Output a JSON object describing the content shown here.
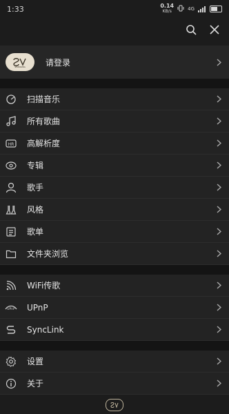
{
  "status": {
    "time": "1:33",
    "speed": "0.14",
    "speed_unit": "KB/s",
    "network": "4G"
  },
  "login": {
    "label": "请登录",
    "avatar_text": "SHANLING"
  },
  "library": [
    {
      "key": "scan",
      "label": "扫描音乐",
      "icon": "refresh-icon"
    },
    {
      "key": "all-songs",
      "label": "所有歌曲",
      "icon": "music-note-icon"
    },
    {
      "key": "hires",
      "label": "高解析度",
      "icon": "hr-badge-icon"
    },
    {
      "key": "album",
      "label": "专辑",
      "icon": "disc-icon"
    },
    {
      "key": "artist",
      "label": "歌手",
      "icon": "person-icon"
    },
    {
      "key": "genre",
      "label": "风格",
      "icon": "flask-icon"
    },
    {
      "key": "playlist",
      "label": "歌单",
      "icon": "playlist-icon"
    },
    {
      "key": "folder",
      "label": "文件夹浏览",
      "icon": "folder-icon"
    }
  ],
  "network_sources": [
    {
      "key": "wifi",
      "label": "WiFi传歌",
      "icon": "wifi-icon"
    },
    {
      "key": "upnp",
      "label": "UPnP",
      "icon": "upnp-icon"
    },
    {
      "key": "synclink",
      "label": "SyncLink",
      "icon": "synclink-icon"
    }
  ],
  "app_menu": [
    {
      "key": "settings",
      "label": "设置",
      "icon": "gear-icon"
    },
    {
      "key": "about",
      "label": "关于",
      "icon": "info-icon"
    }
  ],
  "colors": {
    "background": "#1c1c1c",
    "row": "#232323",
    "separator": "#141414",
    "text": "#e6e6e6",
    "icon": "#cfcfcf",
    "avatar": "#e7dfcf"
  }
}
